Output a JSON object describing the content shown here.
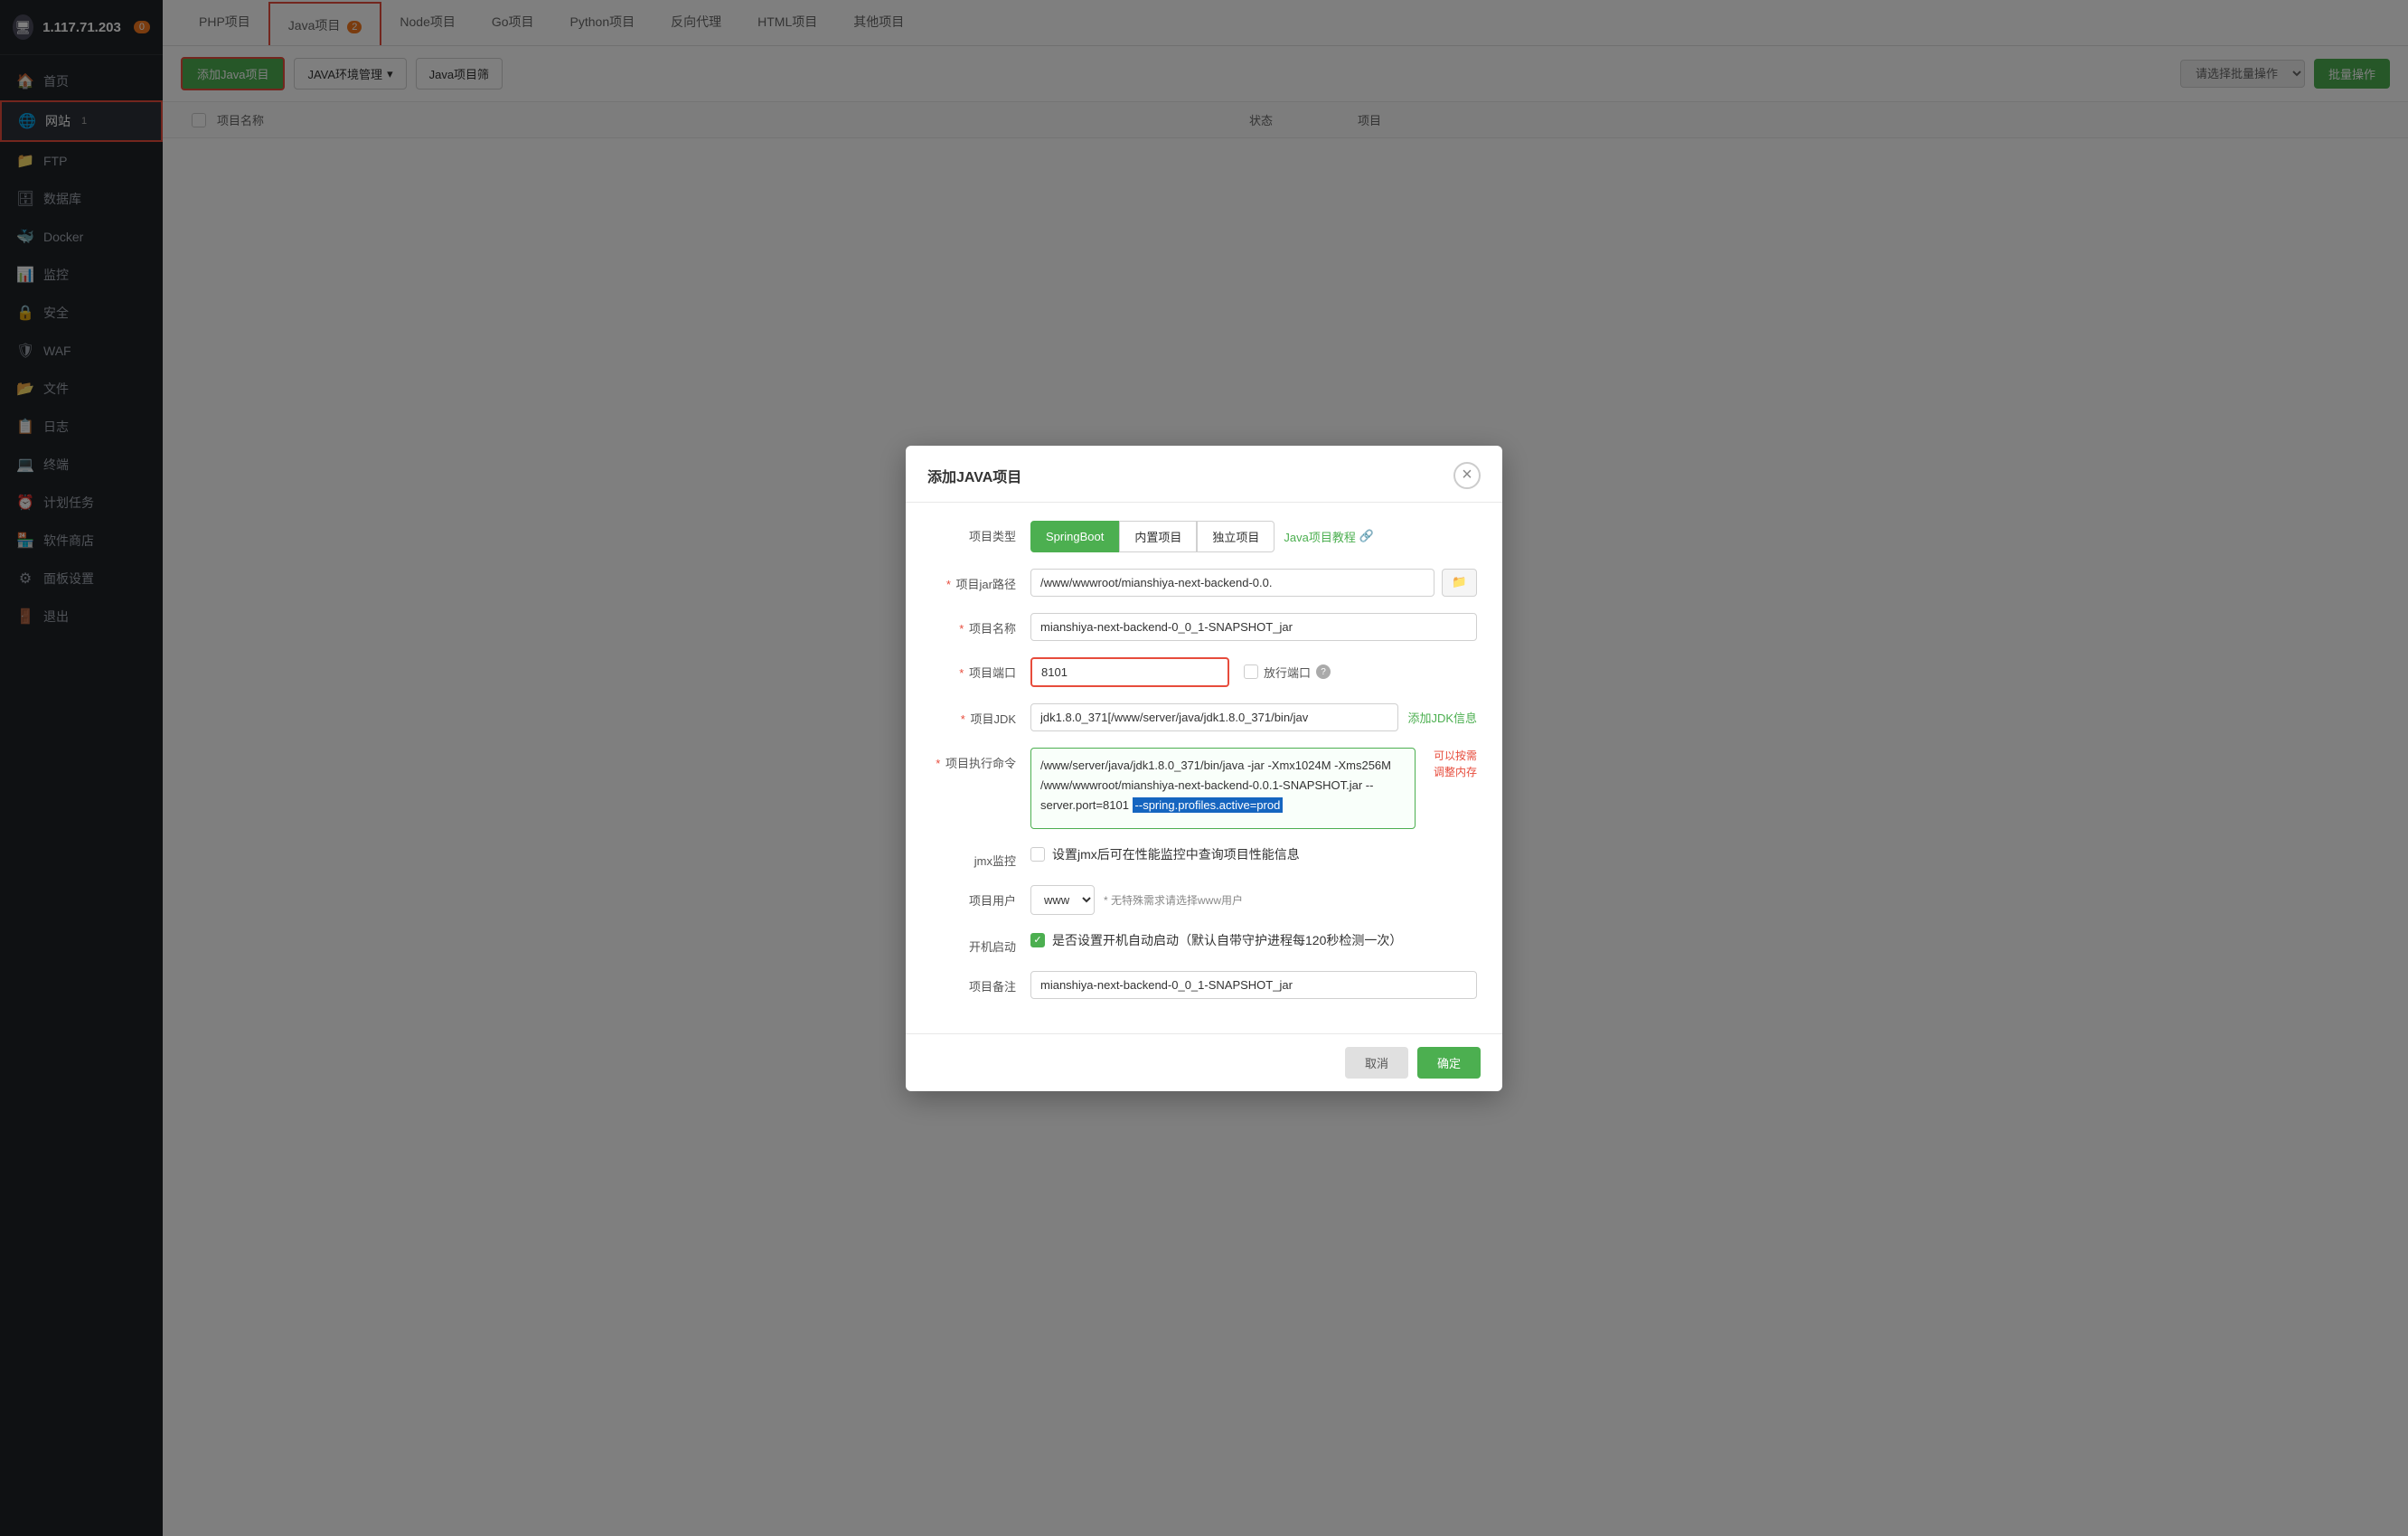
{
  "sidebar": {
    "server_ip": "1.117.71.203",
    "server_badge": "0",
    "items": [
      {
        "id": "home",
        "label": "首页",
        "icon": "🏠"
      },
      {
        "id": "website",
        "label": "网站",
        "icon": "🌐",
        "active": true
      },
      {
        "id": "ftp",
        "label": "FTP",
        "icon": "📁"
      },
      {
        "id": "database",
        "label": "数据库",
        "icon": "🗄"
      },
      {
        "id": "docker",
        "label": "Docker",
        "icon": "🐳"
      },
      {
        "id": "monitor",
        "label": "监控",
        "icon": "📊"
      },
      {
        "id": "security",
        "label": "安全",
        "icon": "🔒"
      },
      {
        "id": "waf",
        "label": "WAF",
        "icon": "🛡"
      },
      {
        "id": "files",
        "label": "文件",
        "icon": "📂"
      },
      {
        "id": "logs",
        "label": "日志",
        "icon": "📋"
      },
      {
        "id": "terminal",
        "label": "终端",
        "icon": "💻"
      },
      {
        "id": "crontask",
        "label": "计划任务",
        "icon": "⏰"
      },
      {
        "id": "appstore",
        "label": "软件商店",
        "icon": "🏪"
      },
      {
        "id": "settings",
        "label": "面板设置",
        "icon": "⚙"
      },
      {
        "id": "logout",
        "label": "退出",
        "icon": "🚪"
      }
    ]
  },
  "tabs": [
    {
      "id": "php",
      "label": "PHP项目"
    },
    {
      "id": "java",
      "label": "Java项目",
      "active": true,
      "highlighted": true,
      "badge": "2"
    },
    {
      "id": "node",
      "label": "Node项目"
    },
    {
      "id": "go",
      "label": "Go项目"
    },
    {
      "id": "python",
      "label": "Python项目"
    },
    {
      "id": "reverse",
      "label": "反向代理"
    },
    {
      "id": "html",
      "label": "HTML项目"
    },
    {
      "id": "other",
      "label": "其他项目"
    }
  ],
  "toolbar": {
    "add_btn": "添加Java项目",
    "env_btn": "JAVA环境管理",
    "project_filter": "Java项目筛",
    "select_placeholder": "请选择批量操作",
    "batch_btn": "批量操作"
  },
  "table": {
    "columns": [
      "项目名称",
      "状态",
      "项目"
    ]
  },
  "dialog": {
    "title": "添加JAVA项目",
    "close_btn": "×",
    "project_type_label": "项目类型",
    "type_options": [
      {
        "id": "springboot",
        "label": "SpringBoot",
        "active": true
      },
      {
        "id": "builtin",
        "label": "内置项目"
      },
      {
        "id": "standalone",
        "label": "独立项目"
      }
    ],
    "tutorial_link": "Java项目教程",
    "jar_path_label": "项目jar路径",
    "jar_path_value": "/www/wwwroot/mianshiya-next-backend-0.0.",
    "jar_path_placeholder": "/www/wwwroot/mianshiya-next-backend-0.0.",
    "folder_icon": "📁",
    "project_name_label": "项目名称",
    "project_name_value": "mianshiya-next-backend-0_0_1-SNAPSHOT_jar",
    "port_label": "项目端口",
    "port_value": "8101",
    "firewall_label": "放行端口",
    "jdk_label": "项目JDK",
    "jdk_value": "jdk1.8.0_371[/www/server/java/jdk1.8.0_371/bin/jav",
    "add_jdk_link": "添加JDK信息",
    "cmd_label": "项目执行命令",
    "cmd_value": "/www/server/java/jdk1.8.0_371/bin/java  -jar -Xmx1024M -Xms256M  /www/wwwroot/mianshiya-next-backend-0.0.1-SNAPSHOT.jar --server.port=8101 --spring.profiles.active=prod",
    "cmd_hint": "可以按需\n调整内存",
    "highlighted_cmd": "--spring.profiles.active=prod",
    "jmx_label": "jmx监控",
    "jmx_hint": "设置jmx后可在性能监控中查询项目性能信息",
    "user_label": "项目用户",
    "user_value": "www",
    "user_hint": "* 无特殊需求请选择www用户",
    "autostart_label": "开机启动",
    "autostart_hint": "是否设置开机自动启动（默认自带守护进程每120秒检测一次）",
    "note_label": "项目备注",
    "note_value": "mianshiya-next-backend-0_0_1-SNAPSHOT_jar",
    "cancel_btn": "取消",
    "confirm_btn": "确定"
  }
}
